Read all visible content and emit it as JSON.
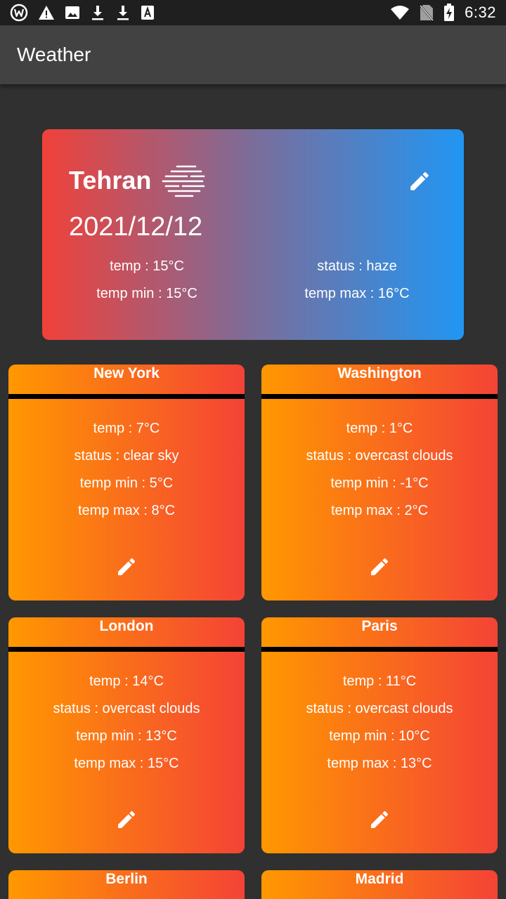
{
  "status_bar": {
    "time": "6:32",
    "left_icons": [
      "app-w-icon",
      "warning-icon",
      "image-icon",
      "download-icon",
      "download-icon",
      "text-a-icon"
    ],
    "right_icons": [
      "wifi-icon",
      "no-sim-icon",
      "battery-charging-icon"
    ]
  },
  "app_bar": {
    "title": "Weather"
  },
  "main_card": {
    "city": "Tehran",
    "date": "2021/12/12",
    "temp": "temp : 15°C",
    "status": "status : haze",
    "temp_min": "temp min : 15°C",
    "temp_max": "temp max : 16°C",
    "weather_icon": "haze-icon",
    "edit_icon": "pencil-icon",
    "gradient": [
      "#f0413a",
      "#2196f3"
    ]
  },
  "cities": [
    {
      "name": "New York",
      "temp": "temp :  7°C",
      "status": "status : clear sky",
      "temp_min": "temp min : 5°C",
      "temp_max": "temp max : 8°C"
    },
    {
      "name": "Washington",
      "temp": "temp :  1°C",
      "status": "status : overcast clouds",
      "temp_min": "temp min : -1°C",
      "temp_max": "temp max : 2°C"
    },
    {
      "name": "London",
      "temp": "temp :  14°C",
      "status": "status : overcast clouds",
      "temp_min": "temp min : 13°C",
      "temp_max": "temp max : 15°C"
    },
    {
      "name": "Paris",
      "temp": "temp :  11°C",
      "status": "status : overcast clouds",
      "temp_min": "temp min : 10°C",
      "temp_max": "temp max : 13°C"
    },
    {
      "name": "Berlin"
    },
    {
      "name": "Madrid"
    }
  ],
  "colors": {
    "background": "#303030",
    "app_bar": "#424242",
    "card_gradient": [
      "#ff9800",
      "#f44336"
    ]
  }
}
